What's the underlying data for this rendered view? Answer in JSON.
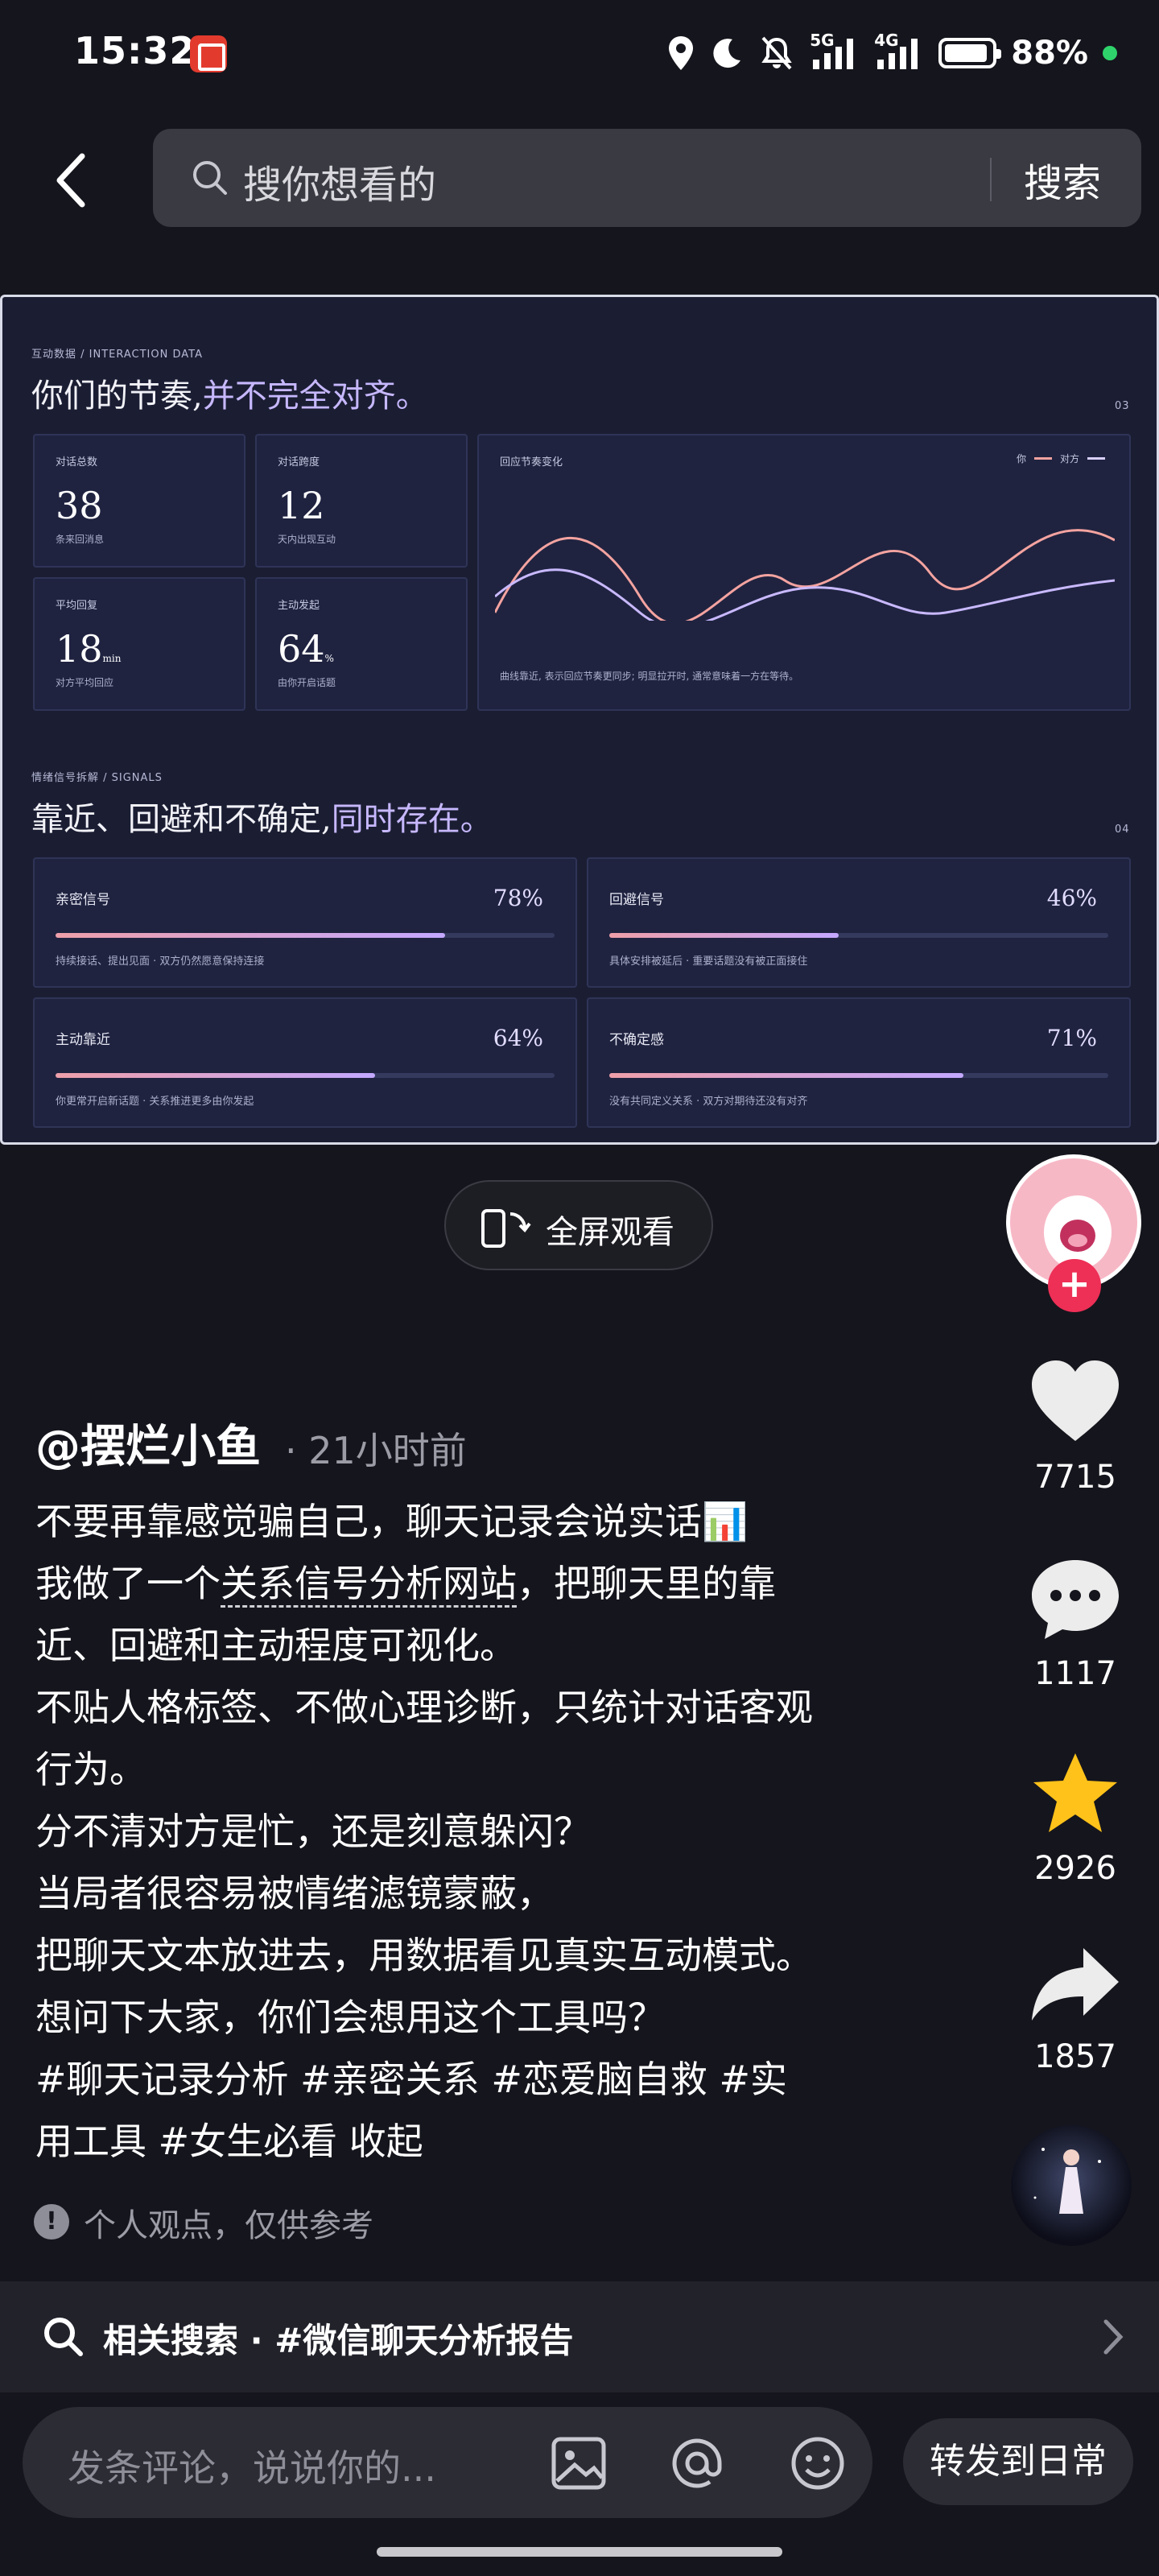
{
  "status_bar": {
    "time": "15:32",
    "net1": "5G",
    "net2": "4G",
    "battery": "88%",
    "icons": [
      "location-icon",
      "moon-icon",
      "mute-icon",
      "signal-icon",
      "battery-icon"
    ]
  },
  "search": {
    "placeholder": "搜你想看的",
    "button": "搜索"
  },
  "video": {
    "section1_tag": "互动数据 / INTERACTION DATA",
    "section1_title": "你们的节奏,",
    "section1_title_accent": "并不完全对齐。",
    "section1_index": "03",
    "stats": [
      {
        "label": "对话总数",
        "value": "38",
        "unit": "",
        "note": "条来回消息"
      },
      {
        "label": "对话跨度",
        "value": "12",
        "unit": "",
        "note": "天内出现互动"
      },
      {
        "label": "平均回复",
        "value": "18",
        "unit": "min",
        "note": "对方平均回应"
      },
      {
        "label": "主动发起",
        "value": "64",
        "unit": "%",
        "note": "由你开启话题"
      }
    ],
    "rhythm": {
      "title": "回应节奏变化",
      "legend": [
        "你",
        "对方"
      ],
      "note": "曲线靠近, 表示回应节奏更同步; 明显拉开时, 通常意味着一方在等待。"
    },
    "section2_tag": "情绪信号拆解 / SIGNALS",
    "section2_title": "靠近、回避和不确定,",
    "section2_title_accent": "同时存在。",
    "section2_index": "04",
    "signals": [
      {
        "title": "亲密信号",
        "percent": "78%",
        "level": 0.78,
        "desc": "持续接话、提出见面 · 双方仍然愿意保持连接"
      },
      {
        "title": "回避信号",
        "percent": "46%",
        "level": 0.46,
        "desc": "具体安排被延后 · 重要话题没有被正面接住"
      },
      {
        "title": "主动靠近",
        "percent": "64%",
        "level": 0.64,
        "desc": "你更常开启新话题 · 关系推进更多由你发起"
      },
      {
        "title": "不确定感",
        "percent": "71%",
        "level": 0.71,
        "desc": "没有共同定义关系 · 双方对期待还没有对齐"
      }
    ]
  },
  "fullscreen_label": "全屏观看",
  "actions": {
    "likes": "7715",
    "comments": "1117",
    "favorites": "2926",
    "shares": "1857"
  },
  "post": {
    "author": "@摆烂小鱼",
    "time": "· 21小时前",
    "lines": [
      "不要再靠感觉骗自己，聊天记录会说实话📊",
      "我做了一个",
      "关系信号分析网站",
      "，把聊天里的靠",
      "近、回避和主动程度可视化。",
      "不贴人格标签、不做心理诊断，只统计对话客观",
      "行为。",
      "分不清对方是忙，还是刻意躲闪？",
      "当局者很容易被情绪滤镜蒙蔽，",
      "把聊天文本放进去，用数据看见真实互动模式。",
      "想问下大家，你们会想用这个工具吗？",
      "#聊天记录分析 #亲密关系 #恋爱脑自救 #实",
      "用工具 #女生必看",
      "收起"
    ],
    "notice": "个人观点，仅供参考"
  },
  "related": {
    "text": "相关搜索 · #微信聊天分析报告"
  },
  "comment_bar": {
    "placeholder": "发条评论，说说你的...",
    "share_button": "转发到日常"
  },
  "colors": {
    "background": "#15151d",
    "accent_red": "#ee2f56",
    "star": "#ffc21a",
    "dashboard_bg": "#1b1e33"
  }
}
